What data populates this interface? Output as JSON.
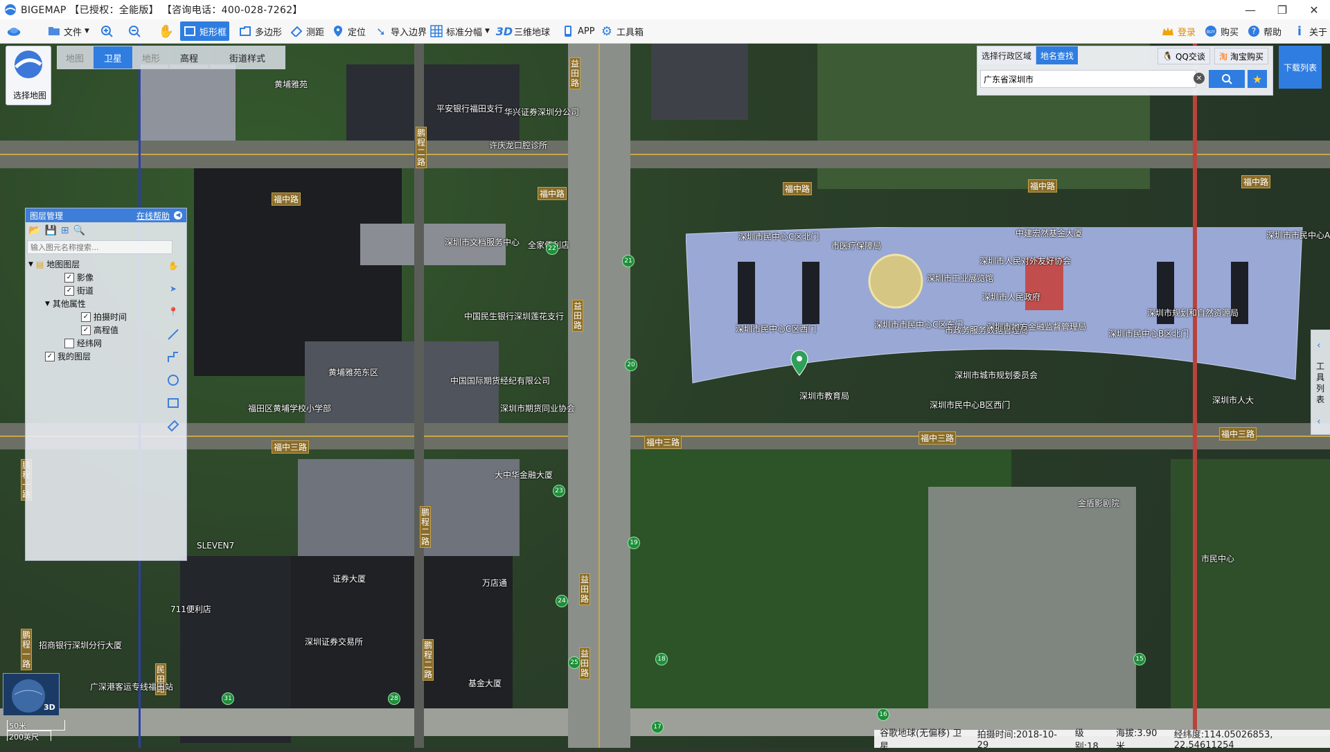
{
  "titlebar": {
    "title": "BIGEMAP 【已授权：全能版】 【咨询电话：400-028-7262】",
    "minimize": "—",
    "restore": "❐",
    "close": "✕"
  },
  "toolbar": {
    "file": "文件",
    "rect": "矩形框",
    "polygon": "多边形",
    "measure": "测距",
    "locate": "定位",
    "import_boundary": "导入边界",
    "std_sheet": "标准分幅",
    "globe_3d": "三维地球",
    "app": "APP",
    "toolbox": "工具箱",
    "login": "登录",
    "buy": "购买",
    "help": "帮助",
    "about": "关于"
  },
  "select_map": {
    "label": "选择地图"
  },
  "map_tabs": [
    "地图",
    "卫星",
    "地形",
    "高程",
    "街道样式"
  ],
  "layer_panel": {
    "title": "图层管理",
    "help": "在线帮助",
    "search_placeholder": "输入图元名称搜索...",
    "items": [
      {
        "label": "地图图层",
        "checked": null
      },
      {
        "label": "影像",
        "checked": true
      },
      {
        "label": "街道",
        "checked": true
      },
      {
        "label": "其他属性",
        "checked": null
      },
      {
        "label": "拍摄时间",
        "checked": true
      },
      {
        "label": "高程值",
        "checked": true
      },
      {
        "label": "经纬网",
        "checked": false
      },
      {
        "label": "我的图层",
        "checked": true
      }
    ]
  },
  "search_panel": {
    "tab_region": "选择行政区域",
    "tab_place": "地名查找",
    "qq": "QQ交谈",
    "taobao": "淘宝购买",
    "value": "广东省深圳市"
  },
  "download_list": "下载列表",
  "right_tab": "工具列表",
  "roads": {
    "fuzhong": "福中路",
    "fuzhong3": "福中三路",
    "yitian": "益田路",
    "pengcheng2": "鹏程二路",
    "pengcheng1": "鹏程一路",
    "minzhong": "民田路"
  },
  "pois": [
    "黄埔雅苑",
    "平安银行福田支行",
    "华兴证券深圳分公司",
    "许庆龙口腔诊所",
    "深圳市民中心C区北门",
    "市医疗保障局",
    "中建宏然基金大厦",
    "深圳市人民对外友好协会",
    "深圳市人民政府",
    "深圳市市民中心A区",
    "深圳市市民中心C区东门",
    "市政务服务数据管理局",
    "深圳市地方金融监督管理局",
    "深圳市工业展览馆",
    "深圳市民中心B区北门",
    "深圳市民中心C区西门",
    "深圳市教育局",
    "深圳市文档服务中心",
    "全家便利店",
    "中国民生银行深圳莲花支行",
    "中国国际期货经纪有限公司",
    "深圳市期货同业协会",
    "黄埔雅苑东区",
    "福田区黄埔学校小学部",
    "大中华金融大厦",
    "SLEVEN7",
    "证券大厦",
    "万店通",
    "711便利店",
    "招商银行深圳分行大厦",
    "深圳证券交易所",
    "广深港客运专线福田站",
    "基金大厦",
    "金盾影剧院",
    "市民中心",
    "深圳市人大",
    "深圳市规划和自然资源局",
    "深圳市民中心B区西门",
    "深圳市城市规划委员会"
  ],
  "scale": {
    "metric": "50米",
    "imperial": "200英尺"
  },
  "status": {
    "source": "谷歌地球(无偏移) 卫星",
    "capture_label": "拍摄时间:",
    "capture": "2018-10-29",
    "level_label": "级别:",
    "level": "18",
    "alt_label": "海拔:",
    "alt": "3.90米",
    "coord_label": "经纬度:",
    "coord": "114.05026853, 22.54611254"
  },
  "colors": {
    "accent": "#2f7de1",
    "road_label": "#8a6d2a",
    "building_roof": "#9aa8d6"
  }
}
